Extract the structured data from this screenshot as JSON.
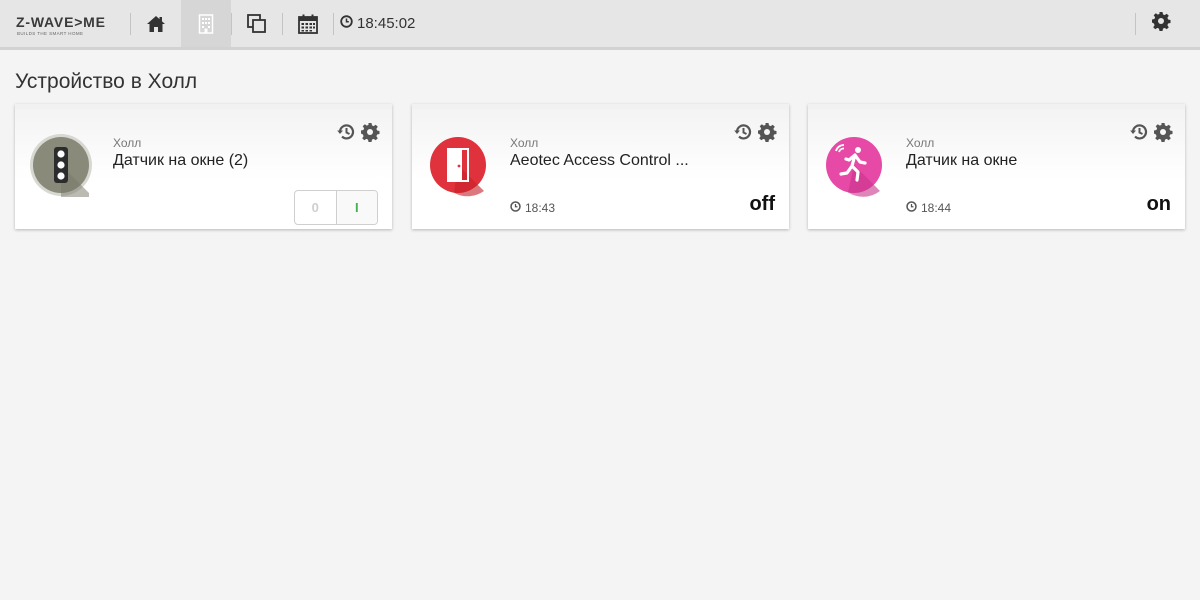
{
  "header": {
    "logo_text": "Z-WAVE>ME",
    "logo_tagline": "BUILDS THE SMART HOME",
    "clock": "18:45:02",
    "nav": [
      {
        "icon": "home-icon"
      },
      {
        "icon": "building-icon",
        "active": true
      },
      {
        "icon": "copy-icon"
      },
      {
        "icon": "calendar-icon"
      }
    ],
    "settings_icon": "gear-icon"
  },
  "page": {
    "title": "Устройство в Холл"
  },
  "cards": [
    {
      "room": "Холл",
      "title": "Датчик на окне (2)",
      "icon": "traffic-light-icon",
      "icon_color": "#8a8a7a",
      "control": "switch",
      "switch_off_label": "0",
      "switch_on_label": "I"
    },
    {
      "room": "Холл",
      "title": "Aeotec Access Control ...",
      "icon": "door-icon",
      "icon_color": "#e0323c",
      "time": "18:43",
      "level": "off"
    },
    {
      "room": "Холл",
      "title": "Датчик на окне",
      "icon": "motion-sensor-icon",
      "icon_color": "#e64aa6",
      "time": "18:44",
      "level": "on"
    }
  ],
  "colors": {
    "topbar": "#e6e6e6",
    "background": "#f4f4f4",
    "switch_on": "#4caf50"
  }
}
